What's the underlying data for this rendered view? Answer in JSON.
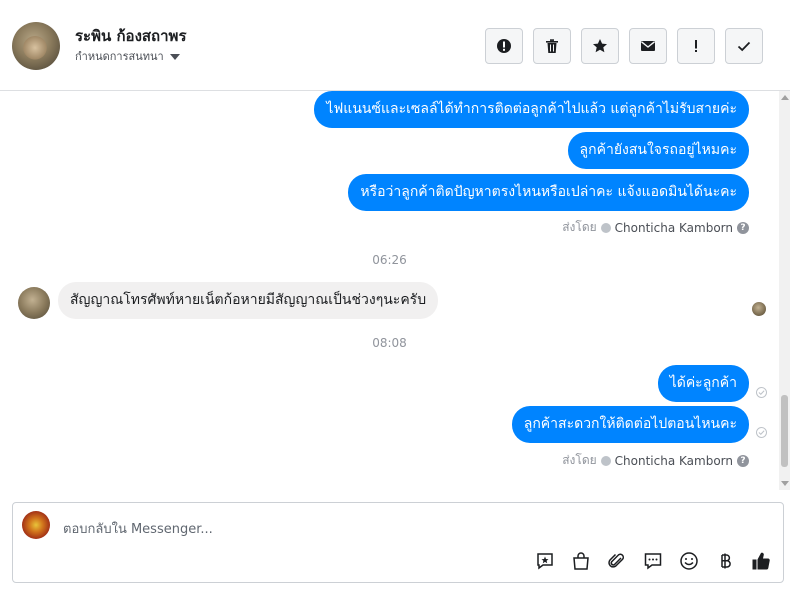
{
  "header": {
    "name": "ระพิน ก้องสถาพร",
    "assign_label": "กำหนดการสนทนา"
  },
  "toolbar": {
    "buttons": [
      "spam-icon",
      "trash-icon",
      "star-icon",
      "envelope-icon",
      "exclamation-icon",
      "check-icon"
    ]
  },
  "thread": {
    "outgoing_group1": [
      "ไฟแนนซ์และเซลล์ได้ทำการติดต่อลูกค้าไปแล้ว แต่ลูกค้าไม่รับสายค่ะ",
      "ลูกค้ายังสนใจรถอยู่ไหมคะ",
      "หรือว่าลูกค้าติดปัญหาตรงไหนหรือเปล่าคะ แจ้งแอดมินได้นะคะ"
    ],
    "sent_by_label": "ส่งโดย",
    "sent_by_name": "Chonticha Kamborn",
    "time1": "06:26",
    "incoming": "สัญญาณโทรศัพท์หายเน็ตก้อหายมีสัญญาณเป็นช่วงๆนะครับ",
    "time2": "08:08",
    "outgoing_group2": [
      "ได้ค่ะลูกค้า",
      "ลูกค้าสะดวกให้ติดต่อไปตอนไหนคะ"
    ]
  },
  "composer": {
    "placeholder": "ตอบกลับใน Messenger...",
    "icons": [
      "saved-reply-icon",
      "shop-bag-icon",
      "attachment-icon",
      "chat-bubble-icon",
      "emoji-icon",
      "baht-icon",
      "like-icon"
    ]
  },
  "colors": {
    "outgoing_bubble": "#0084ff",
    "incoming_bubble": "#f1f0f0"
  }
}
